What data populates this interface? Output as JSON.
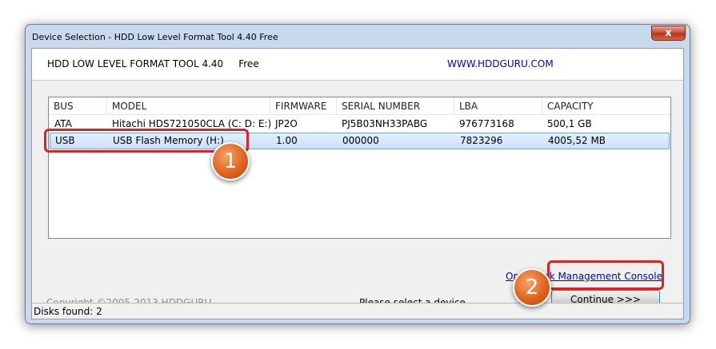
{
  "window": {
    "title": "Device Selection - HDD Low Level Format Tool 4.40     Free",
    "close_symbol": "x"
  },
  "header": {
    "app_title": "HDD LOW LEVEL FORMAT TOOL 4.40     Free",
    "site_link": "WWW.HDDGURU.COM"
  },
  "table": {
    "columns": [
      "BUS",
      "MODEL",
      "FIRMWARE",
      "SERIAL NUMBER",
      "LBA",
      "CAPACITY"
    ],
    "rows": [
      [
        "ATA",
        "Hitachi HDS721050CLA (C: D: E:)",
        "JP2O",
        "PJ5B03NH33PABG",
        "976773168",
        "500,1 GB"
      ],
      [
        "USB",
        "USB Flash Memory (H:)",
        "1.00",
        "000000",
        "7823296",
        "4005,52 MB"
      ]
    ],
    "selected_row": 1
  },
  "footer": {
    "disk_management_link": "Open Disk Management Console",
    "copyright": "Copyright ©2005-2013 HDDGURU",
    "status_message": "Please select a device",
    "continue_label": "Continue >>>",
    "disks_found": "Disks found: 2"
  },
  "annotations": {
    "badge_1": "1",
    "badge_2": "2",
    "highlight_color": "#d7261f",
    "badge_color": "#e0651e"
  }
}
